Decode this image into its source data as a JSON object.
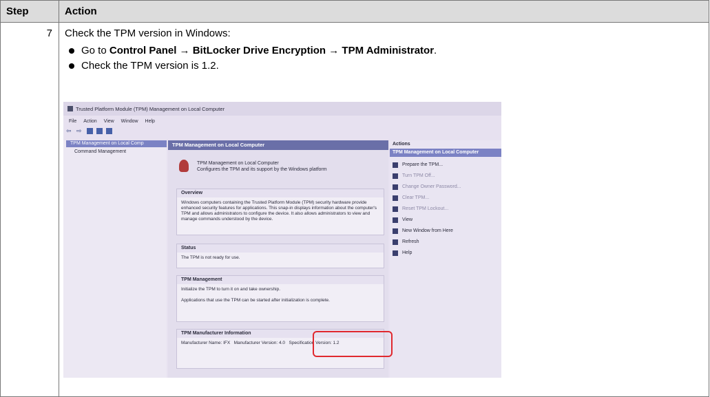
{
  "table": {
    "headers": [
      "Step",
      "Action"
    ],
    "step_number": "7",
    "intro": "Check the TPM version in Windows:",
    "bullet1": {
      "prefix": "Go to ",
      "path": "Control Panel → BitLocker Drive Encryption → TPM Administrator",
      "suffix": "."
    },
    "bullet2": "Check the TPM version is 1.2."
  },
  "screenshot": {
    "window_title": "Trusted Platform Module (TPM) Management on Local Computer",
    "menu": [
      "File",
      "Action",
      "View",
      "Window",
      "Help"
    ],
    "tree": {
      "selected": "TPM Management on Local Comp",
      "child": "Command Management"
    },
    "center_header": "TPM Management on Local Computer",
    "intro_line1": "TPM Management on Local Computer",
    "intro_line2": "Configures the TPM and its support by the Windows platform",
    "overview": {
      "title": "Overview",
      "text": "Windows computers containing the Trusted Platform Module (TPM) security hardware provide enhanced security features for applications. This snap-in displays information about the computer's TPM and allows administrators to configure the device. It also allows administrators to view and manage commands understood by the device."
    },
    "status": {
      "title": "Status",
      "text": "The TPM is not ready for use."
    },
    "tpm_management": {
      "title": "TPM Management",
      "line1": "Initialize the TPM to turn it on and take ownership.",
      "line2": "Applications that use the TPM can be started after initialization is complete."
    },
    "manufacturer": {
      "title": "TPM Manufacturer Information",
      "name_label": "Manufacturer Name:",
      "name_value": "IFX",
      "version_label": "Manufacturer Version:",
      "version_value": "4.0",
      "spec_label": "Specification Version:",
      "spec_value": "1.2"
    },
    "actions": {
      "title": "Actions",
      "selected": "TPM Management on Local Computer",
      "items": [
        {
          "label": "Prepare the TPM...",
          "dim": false
        },
        {
          "label": "Turn TPM Off...",
          "dim": true
        },
        {
          "label": "Change Owner Password...",
          "dim": true
        },
        {
          "label": "Clear TPM...",
          "dim": true
        },
        {
          "label": "Reset TPM Lockout...",
          "dim": true
        },
        {
          "label": "View",
          "dim": false
        },
        {
          "label": "New Window from Here",
          "dim": false
        },
        {
          "label": "Refresh",
          "dim": false
        },
        {
          "label": "Help",
          "dim": false
        }
      ]
    }
  }
}
